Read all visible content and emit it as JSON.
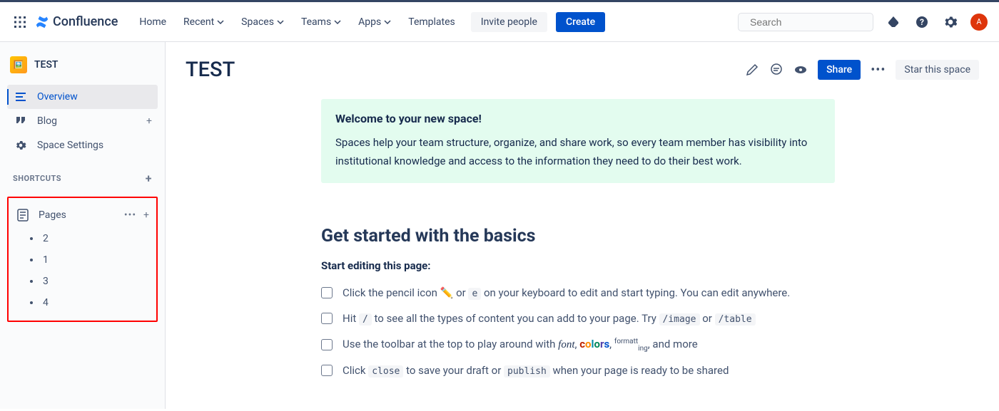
{
  "header": {
    "product": "Confluence",
    "nav": {
      "home": "Home",
      "recent": "Recent",
      "spaces": "Spaces",
      "teams": "Teams",
      "apps": "Apps",
      "templates": "Templates"
    },
    "invite": "Invite people",
    "create": "Create",
    "search_placeholder": "Search",
    "avatar_initial": "A"
  },
  "sidebar": {
    "space_name": "TEST",
    "overview": "Overview",
    "blog": "Blog",
    "space_settings": "Space Settings",
    "shortcuts_label": "SHORTCUTS",
    "pages_label": "Pages",
    "page_children": [
      "2",
      "1",
      "3",
      "4"
    ]
  },
  "page": {
    "title": "TEST",
    "share": "Share",
    "star": "Star this space"
  },
  "panel": {
    "title": "Welcome to your new space!",
    "body": "Spaces help your team structure, organize, and share work, so every team member has visibility into institutional knowledge and access to the information they need to do their best work."
  },
  "basics": {
    "heading": "Get started with the basics",
    "subheading": "Start editing this page:",
    "row1_a": "Click the pencil icon ",
    "row1_b": " or ",
    "row1_kbd": "e",
    "row1_c": " on your keyboard to edit and start typing. You can edit anywhere.",
    "row2_a": "Hit ",
    "row2_kbd1": "/",
    "row2_b": " to see all the types of content you can add to your page. Try ",
    "row2_kbd2": "/image",
    "row2_c": " or ",
    "row2_kbd3": "/table",
    "row3_a": "Use the toolbar at the top to play around with ",
    "row3_font": "font",
    "row3_comma1": ", ",
    "row3_colors": {
      "c": "c",
      "o": "o",
      "l": "l",
      "o2": "o",
      "r": "r",
      "s": "s"
    },
    "row3_comma2": ", ",
    "row3_format": "formatt",
    "row3_ing": "ing",
    "row3_b": ", and more",
    "row4_a": "Click ",
    "row4_kbd1": "close",
    "row4_b": " to save your draft or ",
    "row4_kbd2": "publish",
    "row4_c": " when your page is ready to be shared"
  }
}
